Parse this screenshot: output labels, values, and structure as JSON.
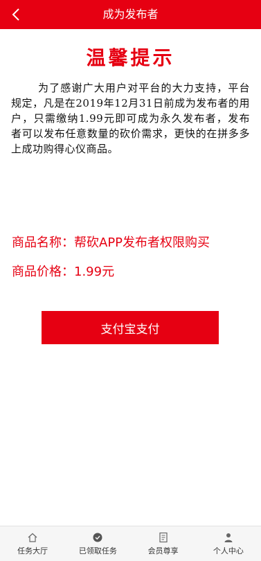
{
  "header": {
    "title": "成为发布者",
    "back_icon": "chevron-left-icon"
  },
  "notice": {
    "title": "温馨提示",
    "body": "为了感谢广大用户对平台的大力支持，平台规定，凡是在2019年12月31日前成为发布者的用户，只需缴纳1.99元即可成为永久发布者，发布者可以发布任意数量的砍价需求，更快的在拼多多上成功购得心仪商品。"
  },
  "product": {
    "name_label": "商品名称：",
    "name_value": "帮砍APP发布者权限购买",
    "price_label": "商品价格：",
    "price_value": "1.99元"
  },
  "pay_button": {
    "label": "支付宝支付"
  },
  "tabbar": {
    "items": [
      {
        "label": "任务大厅",
        "icon": "home-icon"
      },
      {
        "label": "已领取任务",
        "icon": "task-icon"
      },
      {
        "label": "会员尊享",
        "icon": "document-icon"
      },
      {
        "label": "个人中心",
        "icon": "user-icon"
      }
    ]
  },
  "colors": {
    "brand": "#e60012",
    "tabbar_bg": "#f6f6f6"
  }
}
